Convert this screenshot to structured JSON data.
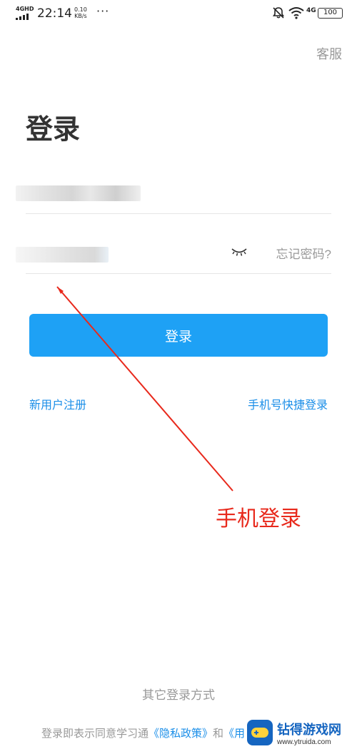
{
  "status_bar": {
    "network": "4GHD",
    "time": "22:14",
    "speed_value": "0.10",
    "speed_unit": "KB/s",
    "more": "···",
    "network_right": "4G",
    "battery": "100",
    "icons": [
      "signal-icon",
      "bell-off-icon",
      "wifi-icon",
      "battery-icon"
    ]
  },
  "header": {
    "service_label": "客服"
  },
  "page": {
    "title": "登录"
  },
  "form": {
    "account": {
      "value": "",
      "obscured": true
    },
    "password": {
      "value": "",
      "obscured": true,
      "eye_icon": "eye-closed-icon"
    },
    "forgot_label": "忘记密码?",
    "login_label": "登录"
  },
  "links": {
    "register": "新用户注册",
    "quick_login": "手机号快捷登录"
  },
  "annotation": {
    "label": "手机登录",
    "color": "#e8291c"
  },
  "footer": {
    "other_login": "其它登录方式",
    "agreement_prefix": "登录即表示同意学习通",
    "privacy_link": "《隐私政策》",
    "conjunction": "和",
    "terms_link": "《用"
  },
  "watermark": {
    "title": "钻得游戏网",
    "url": "www.ytruida.com"
  },
  "colors": {
    "accent": "#1ea1f5",
    "link": "#1a8ee8",
    "muted": "#999999"
  }
}
